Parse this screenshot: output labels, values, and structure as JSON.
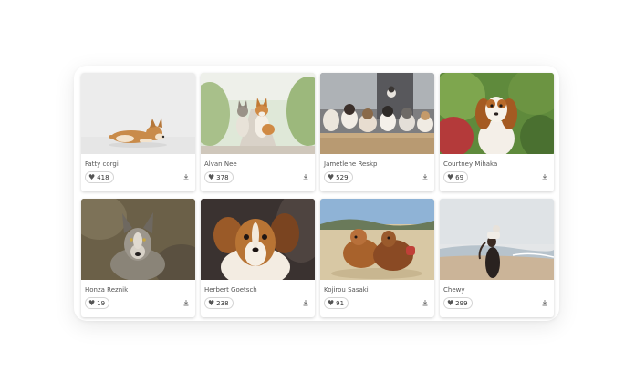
{
  "cards": [
    {
      "author": "Fatty corgi",
      "likes": "418",
      "photo": "corgi lying on white background"
    },
    {
      "author": "Alvan Nee",
      "likes": "378",
      "photo": "two dogs on a garden path"
    },
    {
      "author": "Jametlene Reskp",
      "likes": "529",
      "photo": "litter of puppies on a porch"
    },
    {
      "author": "Courtney Mihaka",
      "likes": "69",
      "photo": "cavalier spaniel in garden"
    },
    {
      "author": "Honza Reznik",
      "likes": "19",
      "photo": "wolfdog lying in grass"
    },
    {
      "author": "Herbert Goetsch",
      "likes": "238",
      "photo": "long-haired chihuahua portrait"
    },
    {
      "author": "Kojirou Sasaki",
      "likes": "91",
      "photo": "two dogs playing on sand"
    },
    {
      "author": "Chewy",
      "likes": "299",
      "photo": "woman holding dog on beach"
    }
  ],
  "icons": {
    "like": "heart-icon",
    "download": "download-icon"
  },
  "colors": {
    "text": "#555555",
    "card_bg": "#ffffff",
    "badge_border": "#d4d4d4"
  }
}
